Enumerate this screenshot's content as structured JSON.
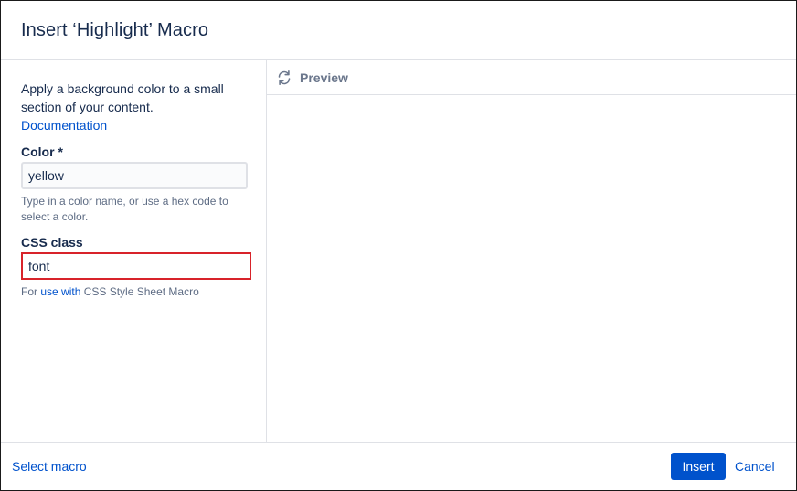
{
  "dialog": {
    "title": "Insert ‘Highlight’ Macro"
  },
  "left_panel": {
    "description": "Apply a background color to a small section of your content.",
    "documentation_link": "Documentation",
    "color_field": {
      "label": "Color *",
      "value": "yellow",
      "help": "Type in a color name, or use a hex code to select a color."
    },
    "css_field": {
      "label": "CSS class",
      "value": "font",
      "help_prefix": "For ",
      "help_link": "use with",
      "help_suffix": " CSS Style Sheet Macro"
    }
  },
  "preview": {
    "icon": "refresh-icon",
    "label": "Preview"
  },
  "footer": {
    "select_macro": "Select macro",
    "insert_label": "Insert",
    "cancel_label": "Cancel"
  },
  "colors": {
    "accent": "#0052cc",
    "highlight_border": "#d8232a",
    "text": "#172b4d",
    "subtle_text": "#5e6c84"
  }
}
